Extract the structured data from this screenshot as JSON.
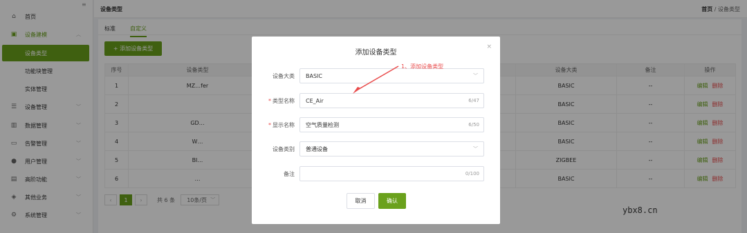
{
  "sidebar": {
    "items": [
      {
        "icon": "home-icon",
        "glyph": "⌂",
        "label": "首页"
      },
      {
        "icon": "device-icon",
        "glyph": "▣",
        "label": "设备建模"
      },
      {
        "label": "设备类型"
      },
      {
        "label": "功能块管理"
      },
      {
        "label": "实体管理"
      },
      {
        "icon": "server-icon",
        "glyph": "☰",
        "label": "设备管理"
      },
      {
        "icon": "chart-icon",
        "glyph": "▥",
        "label": "数据管理"
      },
      {
        "icon": "monitor-icon",
        "glyph": "▭",
        "label": "告警管理"
      },
      {
        "icon": "user-icon",
        "glyph": "●",
        "label": "用户管理"
      },
      {
        "icon": "briefcase-icon",
        "glyph": "▤",
        "label": "高阶功能"
      },
      {
        "icon": "shield-icon",
        "glyph": "◈",
        "label": "其他业务"
      },
      {
        "icon": "gear-icon",
        "glyph": "⚙",
        "label": "系统管理"
      }
    ]
  },
  "header": {
    "title": "设备类型",
    "crumb_home": "首页",
    "crumb_sep": "/",
    "crumb_current": "设备类型"
  },
  "tabs": {
    "standard": "标准",
    "custom": "自定义"
  },
  "add_button": "+ 添加设备类型",
  "table": {
    "headers": [
      "序号",
      "设备类型",
      "",
      "设备大类",
      "备注",
      "操作"
    ],
    "rows": [
      {
        "no": "1",
        "type": "MZ…fer",
        "cat": "BASIC",
        "note": "--"
      },
      {
        "no": "2",
        "type": "",
        "cat": "BASIC",
        "note": "--"
      },
      {
        "no": "3",
        "type": "GD…",
        "cat": "BASIC",
        "note": "--"
      },
      {
        "no": "4",
        "type": "W…",
        "cat": "BASIC",
        "note": "--"
      },
      {
        "no": "5",
        "type": "BI…",
        "cat": "ZIGBEE",
        "note": "--"
      },
      {
        "no": "6",
        "type": "…",
        "cat": "BASIC",
        "note": "--"
      }
    ],
    "edit_label": "编辑",
    "delete_label": "删除"
  },
  "pager": {
    "prev": "‹",
    "current": "1",
    "next": "›",
    "total": "共 6 条",
    "size": "10条/页"
  },
  "modal": {
    "title": "添加设备类型",
    "close": "×",
    "fields": {
      "category": {
        "label": "设备大类",
        "value": "BASIC"
      },
      "type_name": {
        "label": "类型名称",
        "value": "CE_Air",
        "count": "6/47"
      },
      "display_name": {
        "label": "显示名称",
        "value": "空气质量检测",
        "count": "6/50"
      },
      "device_class": {
        "label": "设备类别",
        "value": "普通设备"
      },
      "remark": {
        "label": "备注",
        "value": "",
        "count": "0/100"
      }
    },
    "cancel": "取消",
    "confirm": "确认"
  },
  "annotation": "1、添加设备类型",
  "watermark": "ybx8.cn",
  "colors": {
    "accent": "#6aa11c",
    "danger": "#e94b4b"
  }
}
